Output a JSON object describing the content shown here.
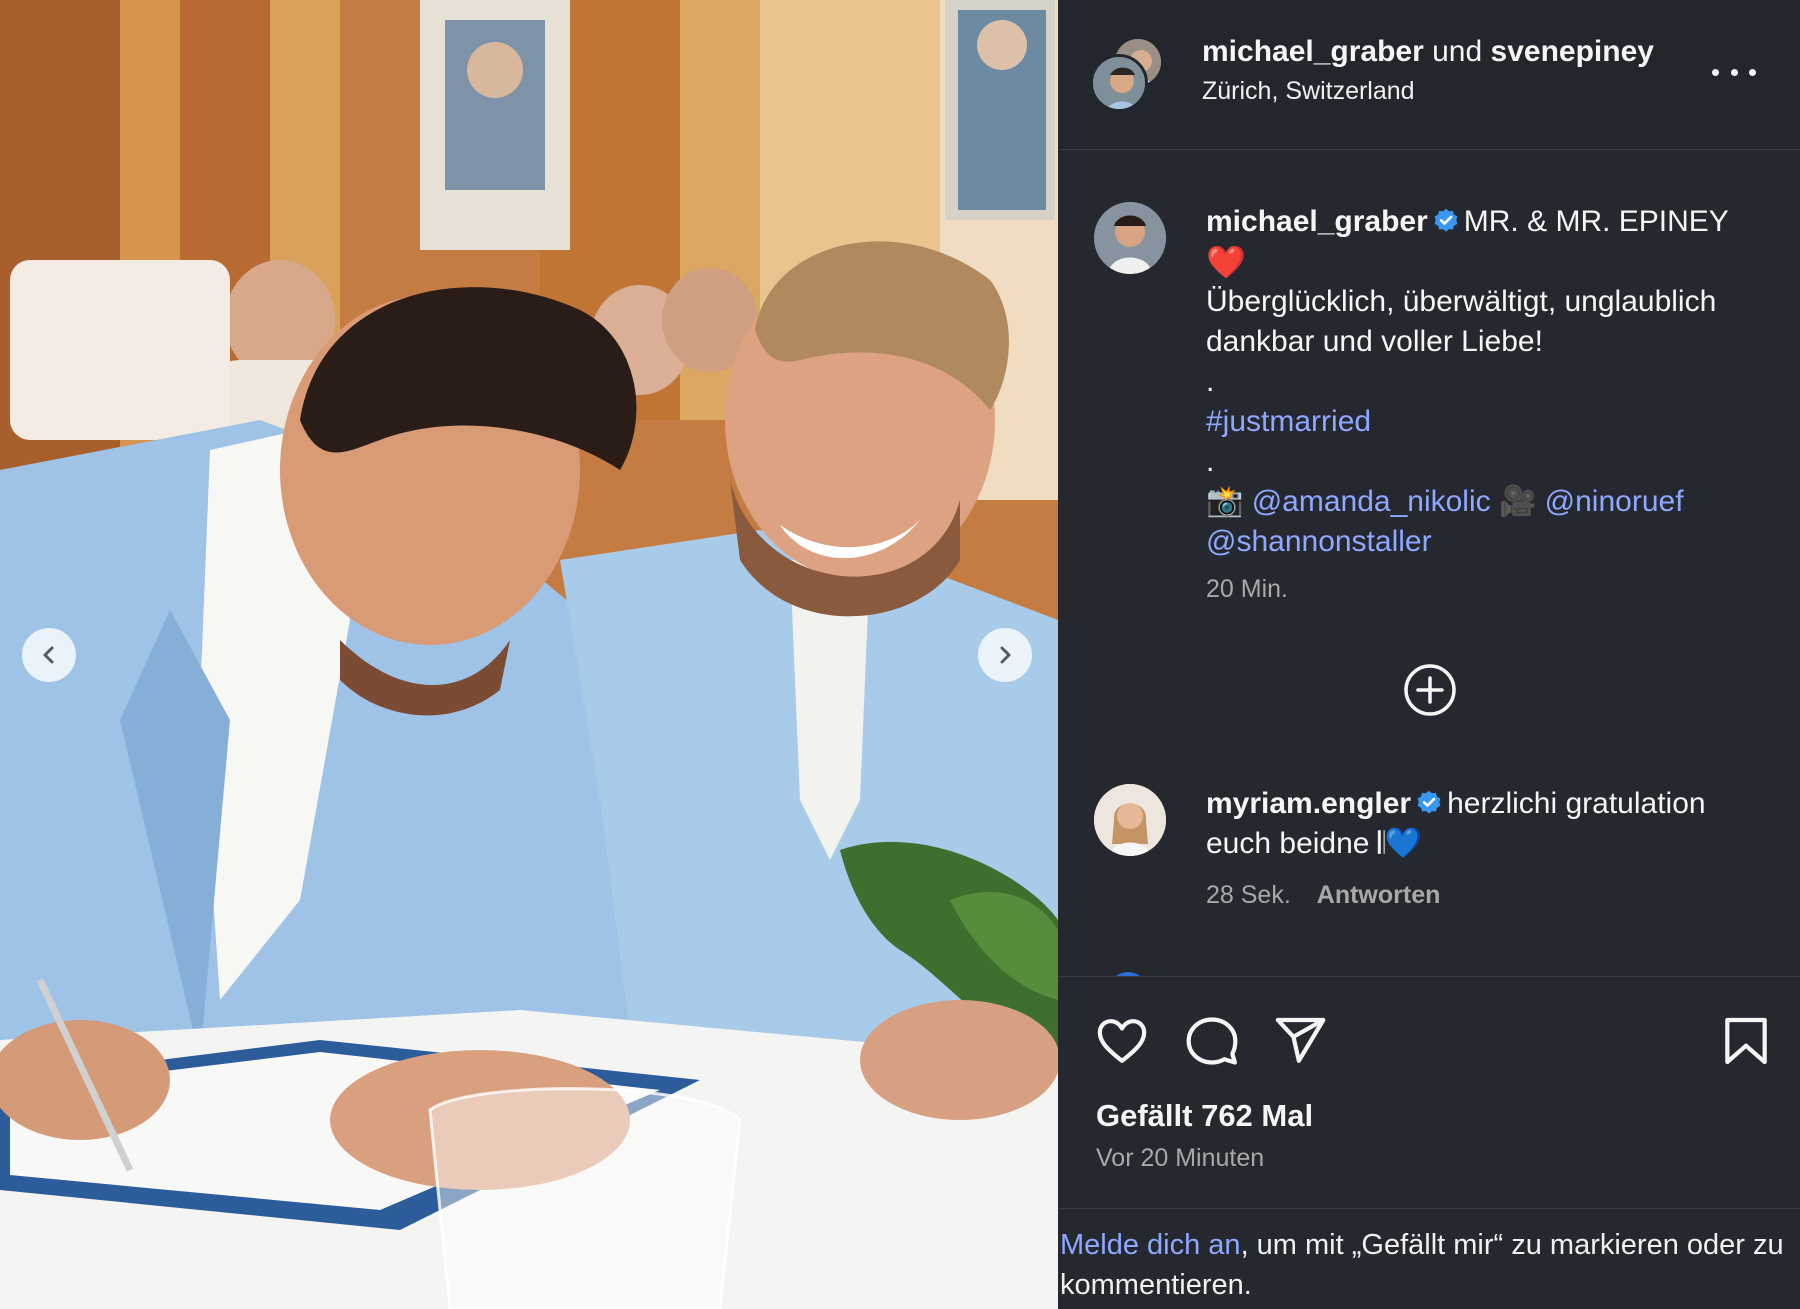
{
  "photo": {
    "alt_name": "wedding-photo",
    "prev_icon": "chevron-left-icon",
    "next_icon": "chevron-right-icon"
  },
  "header": {
    "user1": "michael_graber",
    "joiner": " und ",
    "user2": "svenepiney",
    "location": "Zürich, Switzerland",
    "more_icon": "more-horizontal-icon"
  },
  "caption": {
    "username": "michael_graber",
    "title": "MR. & MR. EPINEY",
    "heart": "❤️",
    "line1": "Überglücklich, überwältigt, unglaublich dankbar und voller Liebe!",
    "dot1": ".",
    "hashtag": "#justmarried",
    "dot2": ".",
    "camera_emoji": "📸",
    "mention1": "@amanda_nikolic",
    "video_emoji": "🎥",
    "mention2": "@ninoruef",
    "mention3": "@shannonstaller",
    "time": "20 Min."
  },
  "comment": {
    "username": "myriam.engler",
    "text_line": "herzlichi gratulation euch beidne",
    "emoji": "𝄃💙",
    "time": "28 Sek.",
    "reply": "Antworten"
  },
  "actions": {
    "like_icon": "heart-icon",
    "comment_icon": "comment-icon",
    "share_icon": "send-icon",
    "save_icon": "bookmark-icon"
  },
  "likes": "Gefällt 762 Mal",
  "ago": "Vor 20 Minuten",
  "login": {
    "link": "Melde dich an",
    "rest": ", um mit „Gefällt mir“ zu markieren oder zu kommentieren."
  },
  "colors": {
    "panel_bg": "#262830",
    "link": "#8ea7ff",
    "verified": "#3897f0",
    "muted": "#a8a8a8"
  }
}
